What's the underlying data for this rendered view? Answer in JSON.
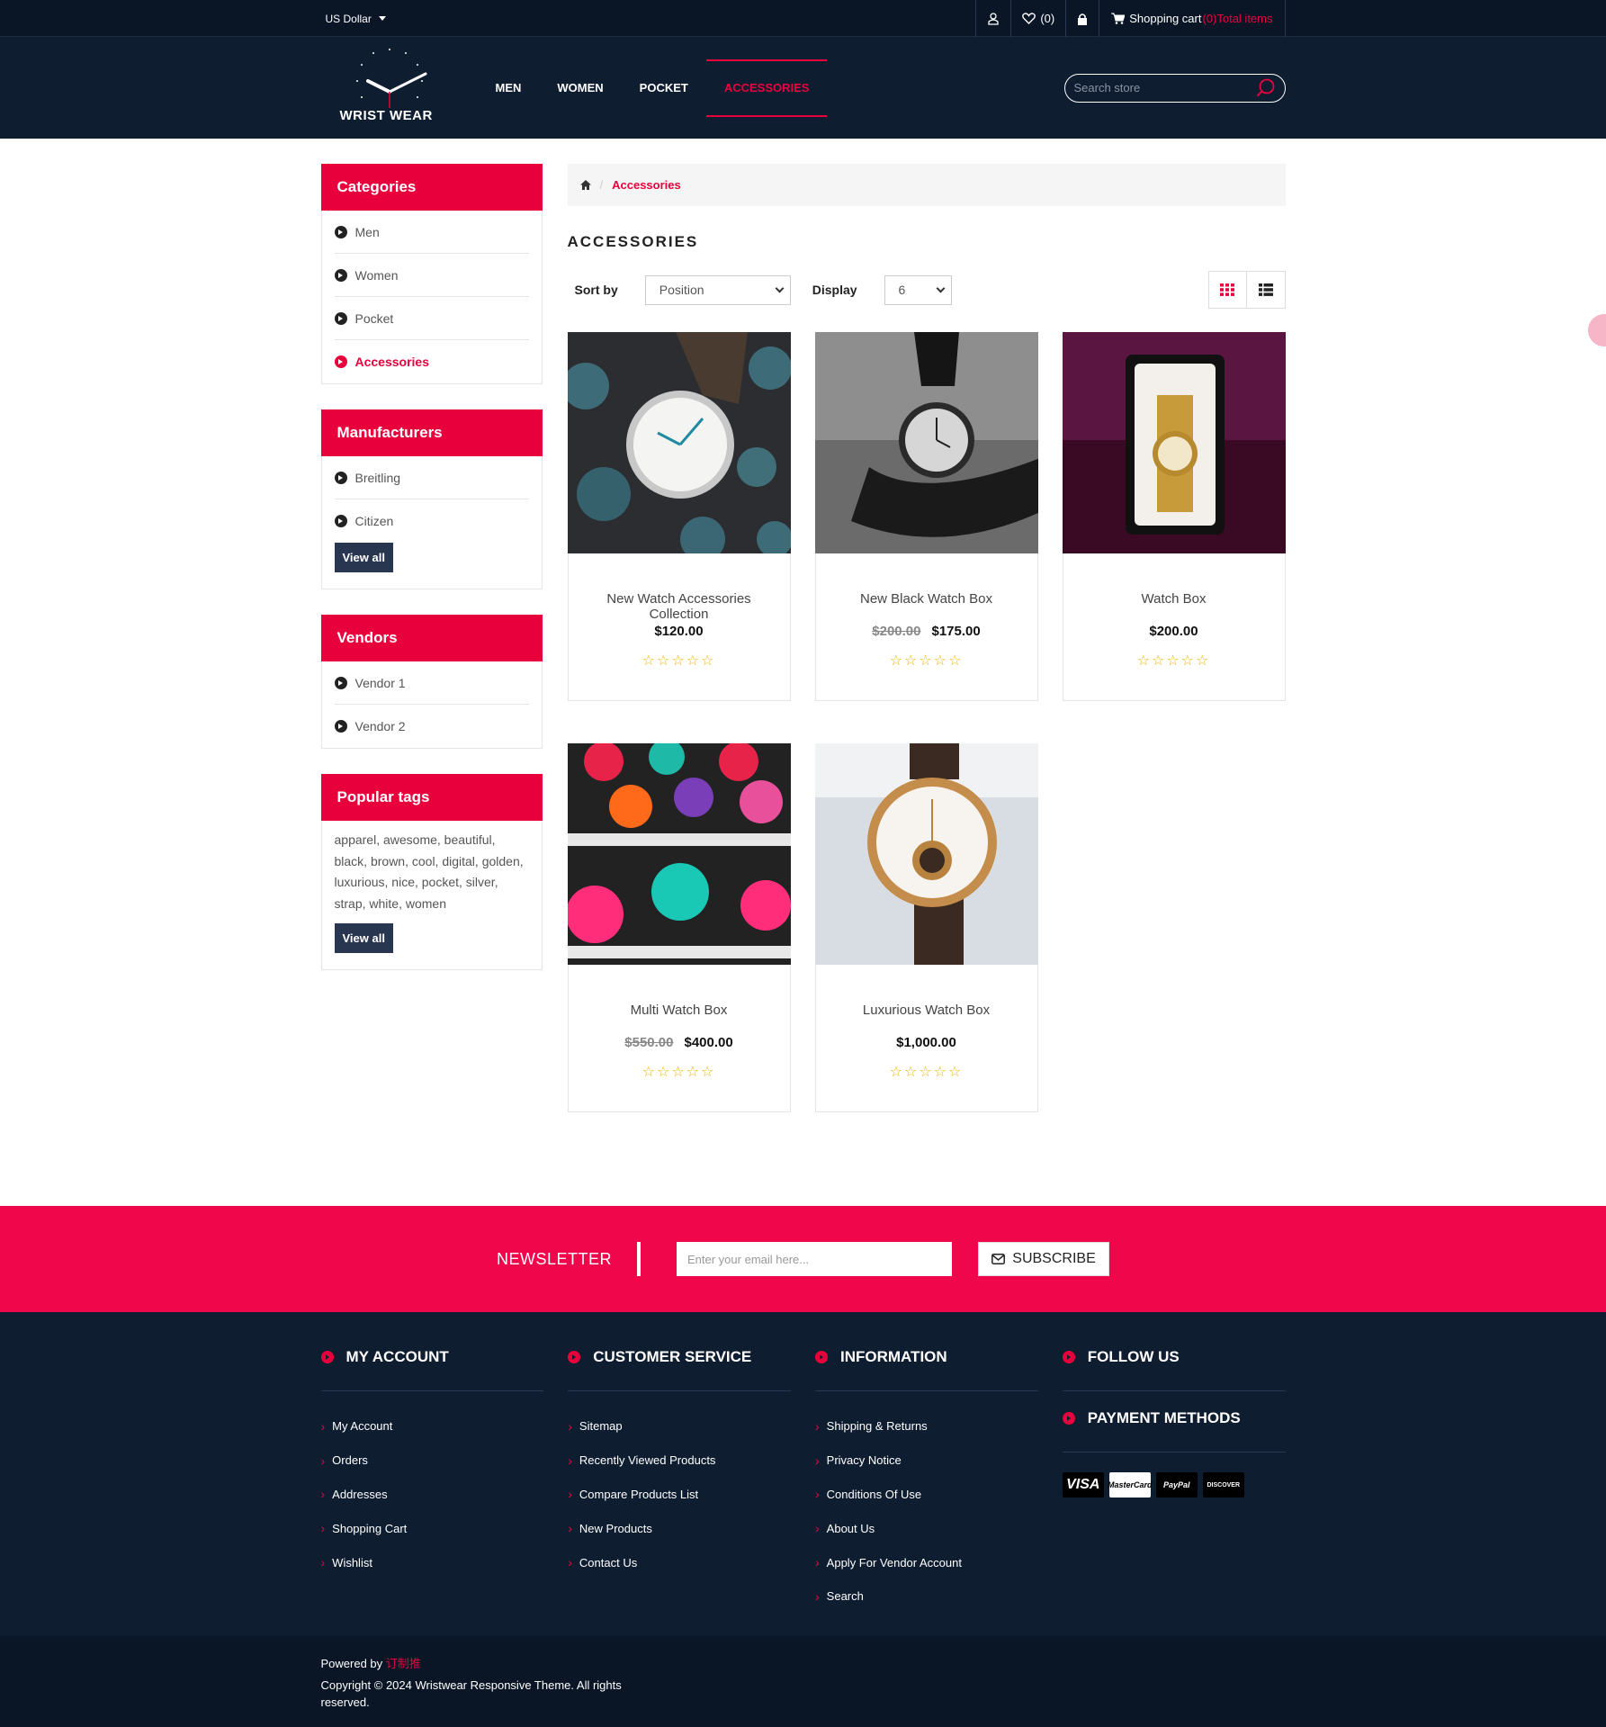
{
  "topbar": {
    "currency": "US Dollar",
    "wishlist": "(0)",
    "cart_label": "Shopping cart",
    "cart_count": "(0)Total items"
  },
  "header": {
    "logo_text": "WRIST WEAR",
    "nav": [
      "MEN",
      "WOMEN",
      "POCKET",
      "ACCESSORIES"
    ],
    "search_placeholder": "Search store"
  },
  "sidebar": {
    "categories_title": "Categories",
    "categories": [
      "Men",
      "Women",
      "Pocket",
      "Accessories"
    ],
    "manufacturers_title": "Manufacturers",
    "manufacturers": [
      "Breitling",
      "Citizen"
    ],
    "view_all": "View all",
    "vendors_title": "Vendors",
    "vendors": [
      "Vendor 1",
      "Vendor 2"
    ],
    "tags_title": "Popular tags",
    "tags": "apparel,  awesome,  beautiful,  black,  brown,  cool,  digital,  golden,  luxurious,  nice,  pocket,  silver,  strap,  white,  women"
  },
  "breadcrumb": {
    "current": "Accessories"
  },
  "page_title": "ACCESSORIES",
  "toolbar": {
    "sort_label": "Sort by",
    "sort_value": "Position",
    "display_label": "Display",
    "display_value": "6"
  },
  "products": [
    {
      "name": "New Watch Accessories Collection",
      "old_price": "",
      "price": "$120.00"
    },
    {
      "name": "New Black Watch Box",
      "old_price": "$200.00",
      "price": "$175.00"
    },
    {
      "name": "Watch Box",
      "old_price": "",
      "price": "$200.00"
    },
    {
      "name": "Multi Watch Box",
      "old_price": "$550.00",
      "price": "$400.00"
    },
    {
      "name": "Luxurious Watch Box",
      "old_price": "",
      "price": "$1,000.00"
    }
  ],
  "rating_stars": "☆☆☆☆☆",
  "newsletter": {
    "label": "NEWSLETTER",
    "placeholder": "Enter your email here...",
    "button": "SUBSCRIBE"
  },
  "footer": {
    "my_account": {
      "title": "MY ACCOUNT",
      "links": [
        "My Account",
        "Orders",
        "Addresses",
        "Shopping Cart",
        "Wishlist"
      ]
    },
    "customer_service": {
      "title": "CUSTOMER SERVICE",
      "links": [
        "Sitemap",
        "Recently Viewed Products",
        "Compare Products List",
        "New Products",
        "Contact Us"
      ]
    },
    "information": {
      "title": "INFORMATION",
      "links": [
        "Shipping & Returns",
        "Privacy Notice",
        "Conditions Of Use",
        "About Us",
        "Apply For Vendor Account",
        "Search"
      ]
    },
    "follow_us": "FOLLOW US",
    "payment_methods": "PAYMENT METHODS",
    "payment_logos": [
      "VISA",
      "MasterCard",
      "PayPal",
      "DISCOVER"
    ],
    "powered_by": "Powered by",
    "powered_by_brand": "订制推",
    "copyright": "Copyright © 2024 Wristwear Responsive Theme. All rights reserved."
  },
  "colors": {
    "accent": "#e8003d",
    "dark": "#0f1d31",
    "darker": "#0a1526",
    "button": "#293650",
    "star": "#f0b400"
  }
}
